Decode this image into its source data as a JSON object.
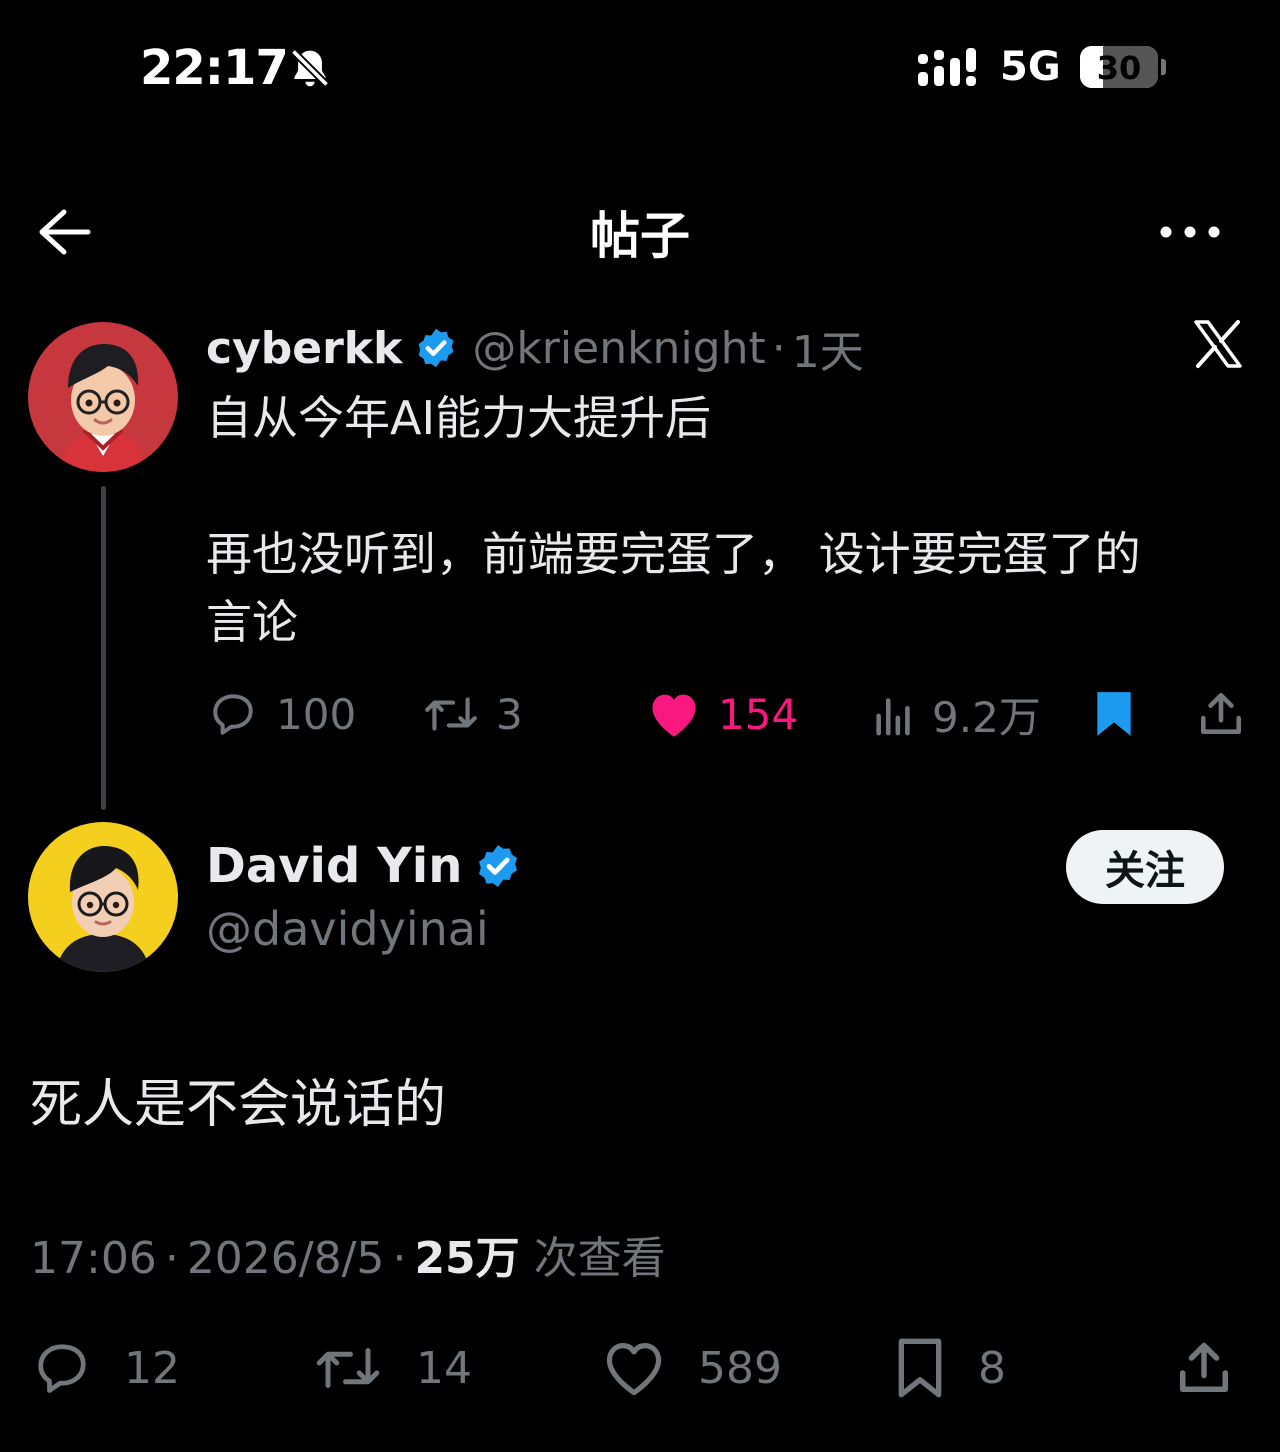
{
  "status_bar": {
    "time": "22:17",
    "network": "5G",
    "battery_percent": 30,
    "battery_label": "30",
    "icons": [
      "bell-muted-icon",
      "signal-icon"
    ]
  },
  "nav": {
    "title": "帖子",
    "icons": [
      "back-arrow-icon",
      "more-icon"
    ]
  },
  "quoted_post": {
    "name": "cyberkk",
    "handle": "@krienknight",
    "separator": "·",
    "age": "1天",
    "lines": [
      "自从今年AI能力大提升后",
      "再也没听到，前端要完蛋了， 设计要完蛋了的",
      "言论"
    ],
    "source_icon": "x-logo-icon",
    "actions": {
      "replies": "100",
      "reposts": "3",
      "likes": "154",
      "views": "9.2万"
    },
    "liked": true,
    "bookmarked": true,
    "colors": {
      "like": "#f91880",
      "bookmark": "#1d9bf0",
      "verified": "#1d9bf0"
    }
  },
  "main_post": {
    "name": "David Yin",
    "handle": "@davidyinai",
    "follow_label": "关注",
    "text": "死人是不会说话的",
    "meta": {
      "time": "17:06",
      "date": "2026/8/5",
      "views_count": "25万",
      "views_label": "次查看",
      "separator": "·"
    },
    "actions": {
      "replies": "12",
      "reposts": "14",
      "likes": "589",
      "bookmarks": "8"
    }
  }
}
